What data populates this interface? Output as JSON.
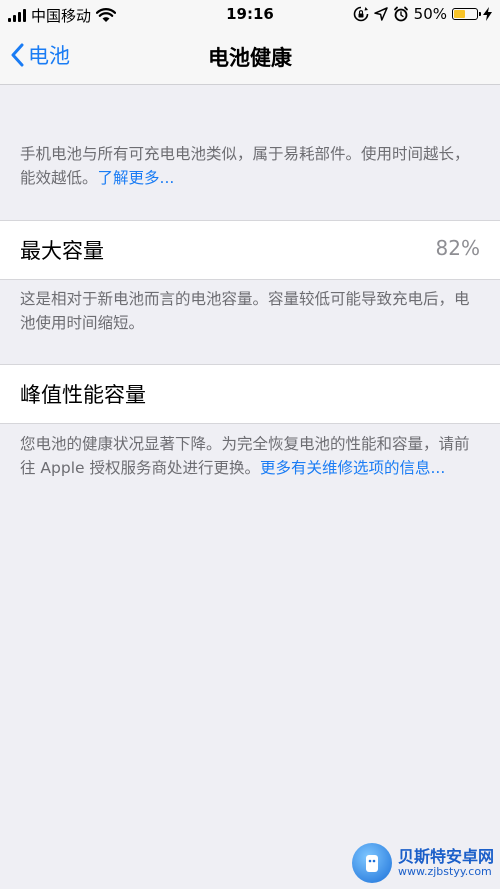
{
  "status_bar": {
    "carrier": "中国移动",
    "time": "19:16",
    "battery_percent": "50%",
    "battery_level": 0.5,
    "battery_color": "#f7c327"
  },
  "nav": {
    "back_label": "电池",
    "title": "电池健康"
  },
  "intro": {
    "text": "手机电池与所有可充电电池类似，属于易耗部件。使用时间越长，能效越低。",
    "link": "了解更多..."
  },
  "max_capacity": {
    "label": "最大容量",
    "value": "82%",
    "footer": "这是相对于新电池而言的电池容量。容量较低可能导致充电后，电池使用时间缩短。"
  },
  "peak_performance": {
    "label": "峰值性能容量",
    "footer": "您电池的健康状况显著下降。为完全恢复电池的性能和容量，请前往 Apple 授权服务商处进行更换。",
    "link": "更多有关维修选项的信息..."
  },
  "watermark": {
    "title": "贝斯特安卓网",
    "url": "www.zjbstyy.com"
  },
  "colors": {
    "accent": "#1a7cf4",
    "background": "#efeff4"
  }
}
